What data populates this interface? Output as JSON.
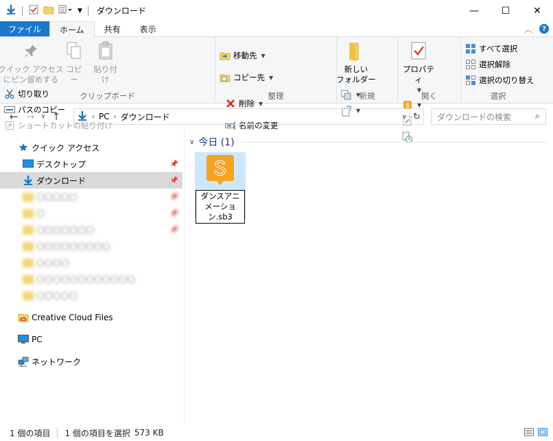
{
  "window": {
    "title": "ダウンロード",
    "controls": {
      "minimize": "—",
      "maximize": "☐",
      "close": "✕"
    }
  },
  "tabs": [
    {
      "label": "ファイル"
    },
    {
      "label": "ホーム"
    },
    {
      "label": "共有"
    },
    {
      "label": "表示"
    }
  ],
  "ribbon": {
    "clipboard": {
      "label": "クリップボード",
      "pin_quick_access": "クイック アクセス\nにピン留めする",
      "copy": "コピー",
      "paste": "貼り付け",
      "cut": "切り取り",
      "copy_path": "パスのコピー",
      "paste_shortcut": "ショートカットの貼り付け"
    },
    "organize": {
      "label": "整理",
      "move_to": "移動先",
      "copy_to": "コピー先",
      "delete": "削除",
      "rename": "名前の変更"
    },
    "new": {
      "label": "新規",
      "new_folder": "新しい\nフォルダー"
    },
    "open": {
      "label": "開く",
      "properties": "プロパティ"
    },
    "select": {
      "label": "選択",
      "select_all": "すべて選択",
      "select_none": "選択解除",
      "invert_selection": "選択の切り替え"
    }
  },
  "address": {
    "segments": [
      "PC",
      "ダウンロード"
    ],
    "search_placeholder": "ダウンロードの検索"
  },
  "nav": {
    "quick_access": "クイック アクセス",
    "desktop": "デスクトップ",
    "downloads": "ダウンロード",
    "blurred_items": [
      "〇〇〇〇〇",
      "〇",
      "〇〇〇〇〇〇〇",
      "〇〇〇〇〇〇〇〇〇",
      "〇〇〇〇",
      "〇〇〇〇〇〇〇〇〇〇〇〇",
      "〇〇〇〇〇"
    ],
    "creative_cloud": "Creative Cloud Files",
    "pc": "PC",
    "network": "ネットワーク"
  },
  "content": {
    "group_header": "今日 (1)",
    "file": {
      "name": "ダンスアニメーション.sb3"
    }
  },
  "status": {
    "item_count": "1 個の項目",
    "selected": "1 個の項目を選択",
    "size": "573 KB"
  },
  "colors": {
    "accent": "#1979ca",
    "selection": "#cce8ff",
    "nav_selected": "#d9d9d9",
    "group_header": "#1e3287"
  }
}
